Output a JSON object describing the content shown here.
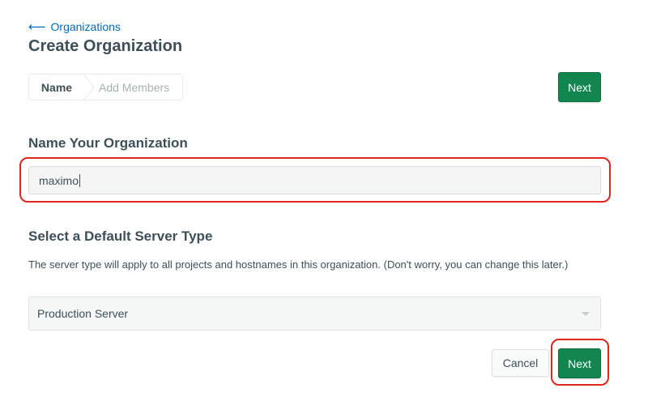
{
  "nav": {
    "back_label": "Organizations"
  },
  "header": {
    "title": "Create Organization"
  },
  "steps": [
    {
      "label": "Name",
      "active": true
    },
    {
      "label": "Add Members",
      "active": false
    }
  ],
  "actions": {
    "next_label": "Next",
    "cancel_label": "Cancel"
  },
  "name_section": {
    "title": "Name Your Organization",
    "input_value": "maximo"
  },
  "server_section": {
    "title": "Select a Default Server Type",
    "help_text": "The server type will apply to all projects and hostnames in this organization. (Don't worry, you can change this later.)",
    "selected_option": "Production Server"
  },
  "colors": {
    "primary": "#13854e",
    "link": "#006cbc",
    "highlight": "#e3261c",
    "text": "#3d4f58"
  }
}
